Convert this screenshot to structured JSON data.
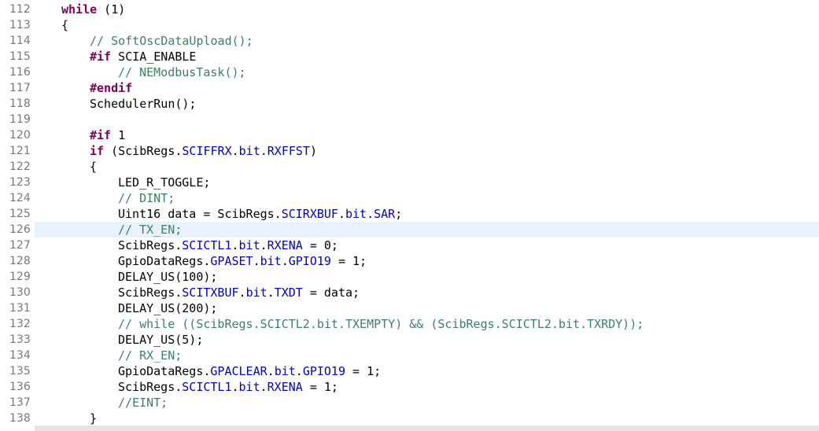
{
  "editor": {
    "current_line": "126",
    "lines": [
      {
        "n": "112",
        "indent": 0,
        "tokens": [
          {
            "t": "kw",
            "v": "while"
          },
          {
            "t": "tx",
            "v": " (1)"
          }
        ]
      },
      {
        "n": "113",
        "indent": 0,
        "tokens": [
          {
            "t": "tx",
            "v": "{"
          }
        ]
      },
      {
        "n": "114",
        "indent": 1,
        "tokens": [
          {
            "t": "cm",
            "v": "// SoftOscDataUpload();"
          }
        ]
      },
      {
        "n": "115",
        "indent": 1,
        "tokens": [
          {
            "t": "pp",
            "v": "#if"
          },
          {
            "t": "tx",
            "v": " SCIA_ENABLE"
          }
        ]
      },
      {
        "n": "116",
        "indent": 2,
        "tokens": [
          {
            "t": "cm",
            "v": "// NEModbusTask();"
          }
        ]
      },
      {
        "n": "117",
        "indent": 1,
        "tokens": [
          {
            "t": "pp",
            "v": "#endif"
          }
        ]
      },
      {
        "n": "118",
        "indent": 1,
        "tokens": [
          {
            "t": "tx",
            "v": "SchedulerRun();"
          }
        ]
      },
      {
        "n": "119",
        "indent": 0,
        "tokens": []
      },
      {
        "n": "120",
        "indent": 1,
        "tokens": [
          {
            "t": "pp",
            "v": "#if"
          },
          {
            "t": "tx",
            "v": " 1"
          }
        ]
      },
      {
        "n": "121",
        "indent": 1,
        "tokens": [
          {
            "t": "kw",
            "v": "if"
          },
          {
            "t": "tx",
            "v": " (ScibRegs."
          },
          {
            "t": "fd",
            "v": "SCIFFRX"
          },
          {
            "t": "tx",
            "v": "."
          },
          {
            "t": "fd",
            "v": "bit"
          },
          {
            "t": "tx",
            "v": "."
          },
          {
            "t": "fd",
            "v": "RXFFST"
          },
          {
            "t": "tx",
            "v": ")"
          }
        ]
      },
      {
        "n": "122",
        "indent": 1,
        "tokens": [
          {
            "t": "tx",
            "v": "{"
          }
        ]
      },
      {
        "n": "123",
        "indent": 2,
        "tokens": [
          {
            "t": "tx",
            "v": "LED_R_TOGGLE;"
          }
        ]
      },
      {
        "n": "124",
        "indent": 2,
        "tokens": [
          {
            "t": "cm",
            "v": "// DINT;"
          }
        ]
      },
      {
        "n": "125",
        "indent": 2,
        "tokens": [
          {
            "t": "tx",
            "v": "Uint16 data = ScibRegs."
          },
          {
            "t": "fd",
            "v": "SCIRXBUF"
          },
          {
            "t": "tx",
            "v": "."
          },
          {
            "t": "fd",
            "v": "bit"
          },
          {
            "t": "tx",
            "v": "."
          },
          {
            "t": "fd",
            "v": "SAR"
          },
          {
            "t": "tx",
            "v": ";"
          }
        ]
      },
      {
        "n": "126",
        "indent": 2,
        "tokens": [
          {
            "t": "cm",
            "v": "// TX_EN;"
          }
        ]
      },
      {
        "n": "127",
        "indent": 2,
        "tokens": [
          {
            "t": "tx",
            "v": "ScibRegs."
          },
          {
            "t": "fd",
            "v": "SCICTL1"
          },
          {
            "t": "tx",
            "v": "."
          },
          {
            "t": "fd",
            "v": "bit"
          },
          {
            "t": "tx",
            "v": "."
          },
          {
            "t": "fd",
            "v": "RXENA"
          },
          {
            "t": "tx",
            "v": " = 0;"
          }
        ]
      },
      {
        "n": "128",
        "indent": 2,
        "tokens": [
          {
            "t": "tx",
            "v": "GpioDataRegs."
          },
          {
            "t": "fd",
            "v": "GPASET"
          },
          {
            "t": "tx",
            "v": "."
          },
          {
            "t": "fd",
            "v": "bit"
          },
          {
            "t": "tx",
            "v": "."
          },
          {
            "t": "fd",
            "v": "GPIO19"
          },
          {
            "t": "tx",
            "v": " = 1;"
          }
        ]
      },
      {
        "n": "129",
        "indent": 2,
        "tokens": [
          {
            "t": "tx",
            "v": "DELAY_US(100);"
          }
        ]
      },
      {
        "n": "130",
        "indent": 2,
        "tokens": [
          {
            "t": "tx",
            "v": "ScibRegs."
          },
          {
            "t": "fd",
            "v": "SCITXBUF"
          },
          {
            "t": "tx",
            "v": "."
          },
          {
            "t": "fd",
            "v": "bit"
          },
          {
            "t": "tx",
            "v": "."
          },
          {
            "t": "fd",
            "v": "TXDT"
          },
          {
            "t": "tx",
            "v": " = data;"
          }
        ]
      },
      {
        "n": "131",
        "indent": 2,
        "tokens": [
          {
            "t": "tx",
            "v": "DELAY_US(200);"
          }
        ]
      },
      {
        "n": "132",
        "indent": 2,
        "tokens": [
          {
            "t": "cm",
            "v": "// while ((ScibRegs.SCICTL2.bit.TXEMPTY) && (ScibRegs.SCICTL2.bit.TXRDY));"
          }
        ]
      },
      {
        "n": "133",
        "indent": 2,
        "tokens": [
          {
            "t": "tx",
            "v": "DELAY_US(5);"
          }
        ]
      },
      {
        "n": "134",
        "indent": 2,
        "tokens": [
          {
            "t": "cm",
            "v": "// RX_EN;"
          }
        ]
      },
      {
        "n": "135",
        "indent": 2,
        "tokens": [
          {
            "t": "tx",
            "v": "GpioDataRegs."
          },
          {
            "t": "fd",
            "v": "GPACLEAR"
          },
          {
            "t": "tx",
            "v": "."
          },
          {
            "t": "fd",
            "v": "bit"
          },
          {
            "t": "tx",
            "v": "."
          },
          {
            "t": "fd",
            "v": "GPIO19"
          },
          {
            "t": "tx",
            "v": " = 1;"
          }
        ]
      },
      {
        "n": "136",
        "indent": 2,
        "tokens": [
          {
            "t": "tx",
            "v": "ScibRegs."
          },
          {
            "t": "fd",
            "v": "SCICTL1"
          },
          {
            "t": "tx",
            "v": "."
          },
          {
            "t": "fd",
            "v": "bit"
          },
          {
            "t": "tx",
            "v": "."
          },
          {
            "t": "fd",
            "v": "RXENA"
          },
          {
            "t": "tx",
            "v": " = 1;"
          }
        ]
      },
      {
        "n": "137",
        "indent": 2,
        "tokens": [
          {
            "t": "cm",
            "v": "//EINT;"
          }
        ]
      },
      {
        "n": "138",
        "indent": 1,
        "tokens": [
          {
            "t": "tx",
            "v": "}"
          }
        ]
      }
    ]
  }
}
